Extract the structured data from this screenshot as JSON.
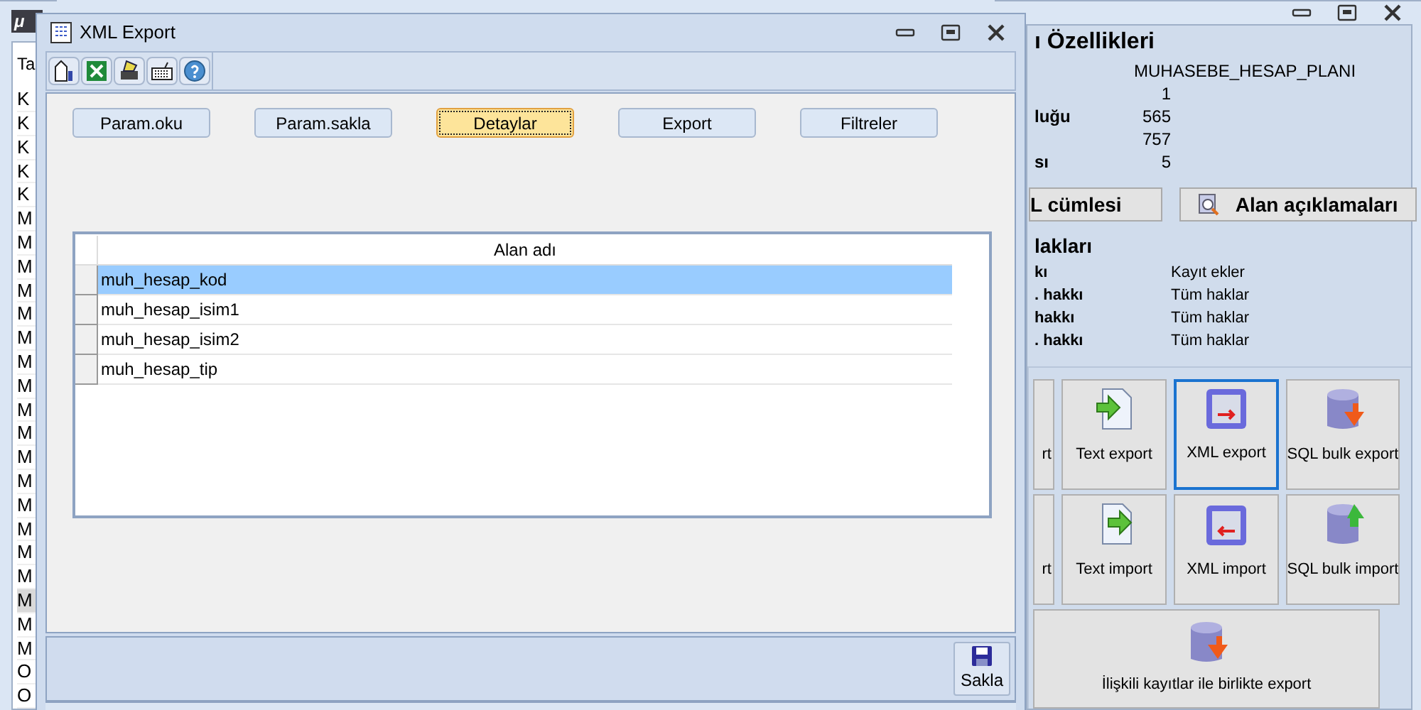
{
  "main_window": {
    "logo": "μ",
    "list_header": "Ta",
    "list_items": [
      {
        "text": "K",
        "selected": false
      },
      {
        "text": "K",
        "selected": false
      },
      {
        "text": "K",
        "selected": false
      },
      {
        "text": "K",
        "selected": false
      },
      {
        "text": "K",
        "selected": false
      },
      {
        "text": "M",
        "selected": false
      },
      {
        "text": "M",
        "selected": false
      },
      {
        "text": "M",
        "selected": false
      },
      {
        "text": "M",
        "selected": false
      },
      {
        "text": "M",
        "selected": false
      },
      {
        "text": "M",
        "selected": false
      },
      {
        "text": "M",
        "selected": false
      },
      {
        "text": "M",
        "selected": false
      },
      {
        "text": "M",
        "selected": false
      },
      {
        "text": "M",
        "selected": false
      },
      {
        "text": "M",
        "selected": false
      },
      {
        "text": "M",
        "selected": false
      },
      {
        "text": "M",
        "selected": false
      },
      {
        "text": "M",
        "selected": false
      },
      {
        "text": "M",
        "selected": false
      },
      {
        "text": "M",
        "selected": false
      },
      {
        "text": "M",
        "selected": true
      },
      {
        "text": "M",
        "selected": false
      },
      {
        "text": "M",
        "selected": false
      },
      {
        "text": "O",
        "selected": false
      },
      {
        "text": "O",
        "selected": false
      }
    ]
  },
  "properties_window": {
    "heading": "ı Özellikleri",
    "properties": [
      {
        "value": "MUHASEBE_HESAP_PLANI",
        "kind": "name"
      },
      {
        "value": "1",
        "kind": "number"
      },
      {
        "label": "luğu",
        "value": "565",
        "kind": "number"
      },
      {
        "value": "757",
        "kind": "number"
      },
      {
        "label": "sı",
        "value": "5",
        "kind": "number"
      }
    ],
    "buttons": [
      {
        "label": "L cümlesi",
        "icon": false
      },
      {
        "label": "Alan açıklamaları",
        "icon": true
      }
    ],
    "rights_heading": "lakları",
    "rights": [
      {
        "label": "kı",
        "value": "Kayıt ekler"
      },
      {
        "label": ". hakkı",
        "value": "Tüm haklar"
      },
      {
        "label": "hakkı",
        "value": "Tüm haklar"
      },
      {
        "label": ". hakkı",
        "value": "Tüm haklar"
      }
    ],
    "tiles": [
      {
        "label": "rt",
        "kind": "partial",
        "selected": false
      },
      {
        "label": "Text export",
        "kind": "text-export",
        "selected": false
      },
      {
        "label": "XML export",
        "kind": "xml-export",
        "selected": true
      },
      {
        "label": "SQL bulk export",
        "kind": "sql-export",
        "selected": false
      },
      {
        "label": "rt",
        "kind": "partial",
        "selected": false
      },
      {
        "label": "Text import",
        "kind": "text-import",
        "selected": false
      },
      {
        "label": "XML import",
        "kind": "xml-import",
        "selected": false
      },
      {
        "label": "SQL bulk import",
        "kind": "sql-import",
        "selected": false
      }
    ],
    "wide_tile": {
      "label": "İlişkili kayıtlar ile birlikte export"
    }
  },
  "dialog": {
    "title": "XML Export",
    "toolbar": [
      {
        "kind": "chart"
      },
      {
        "kind": "excel"
      },
      {
        "kind": "printer"
      },
      {
        "kind": "keyboard"
      },
      {
        "kind": "help"
      }
    ],
    "buttons": [
      {
        "label": "Param.oku",
        "focused": false
      },
      {
        "label": "Param.sakla",
        "focused": false
      },
      {
        "label": "Detaylar",
        "focused": true
      },
      {
        "label": "Export",
        "focused": false
      },
      {
        "label": "Filtreler",
        "focused": false
      }
    ],
    "grid": {
      "column": "Alan adı",
      "rows": [
        {
          "text": "muh_hesap_kod",
          "selected": true
        },
        {
          "text": "muh_hesap_isim1",
          "selected": false
        },
        {
          "text": "muh_hesap_isim2",
          "selected": false
        },
        {
          "text": "muh_hesap_tip",
          "selected": false
        }
      ]
    },
    "save_button": "Sakla"
  }
}
